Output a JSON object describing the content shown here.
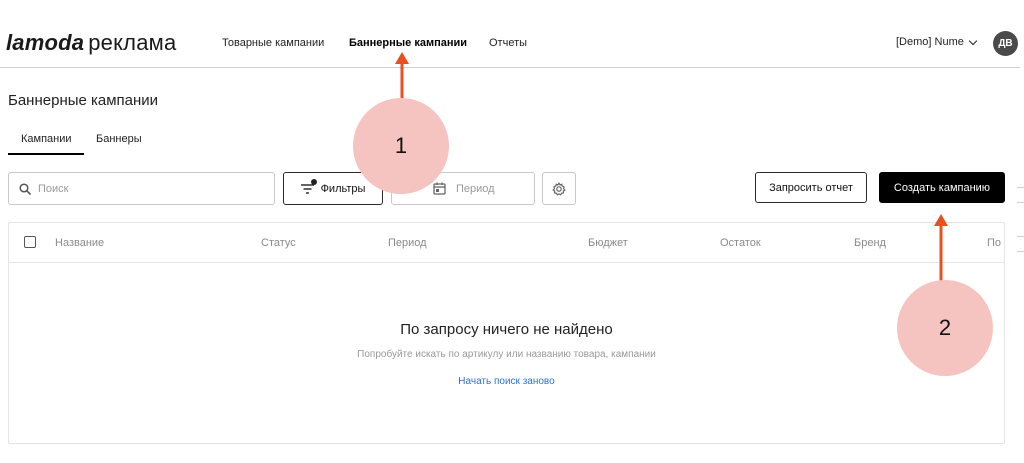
{
  "header": {
    "logo_brand": "lamoda",
    "logo_tail": "реклама",
    "nav": [
      {
        "label": "Товарные кампании",
        "active": false
      },
      {
        "label": "Баннерные кампании",
        "active": true
      },
      {
        "label": "Отчеты",
        "active": false
      }
    ],
    "account_label": "[Demo] Nume",
    "avatar_initials": "ДВ"
  },
  "page": {
    "title": "Баннерные кампании",
    "tabs": [
      {
        "label": "Кампании",
        "active": true
      },
      {
        "label": "Баннеры",
        "active": false
      }
    ]
  },
  "toolbar": {
    "search_placeholder": "Поиск",
    "filters_label": "Фильтры",
    "period_placeholder": "Период",
    "report_label": "Запросить отчет",
    "create_label": "Создать кампанию"
  },
  "table": {
    "columns": [
      "Название",
      "Статус",
      "Период",
      "Бюджет",
      "Остаток",
      "Бренд",
      "По"
    ],
    "empty_title": "По запросу ничего не найдено",
    "empty_subtitle": "Попробуйте искать по артикулу или названию товара, кампании",
    "reset_link": "Начать поиск заново"
  },
  "annotations": [
    {
      "label": "1",
      "color": "#f6c4c0"
    },
    {
      "label": "2",
      "color": "#f6c4c0"
    }
  ],
  "colors": {
    "arrow": "#e8501f",
    "link": "#2f6fd6",
    "primary_button": "#000000"
  }
}
